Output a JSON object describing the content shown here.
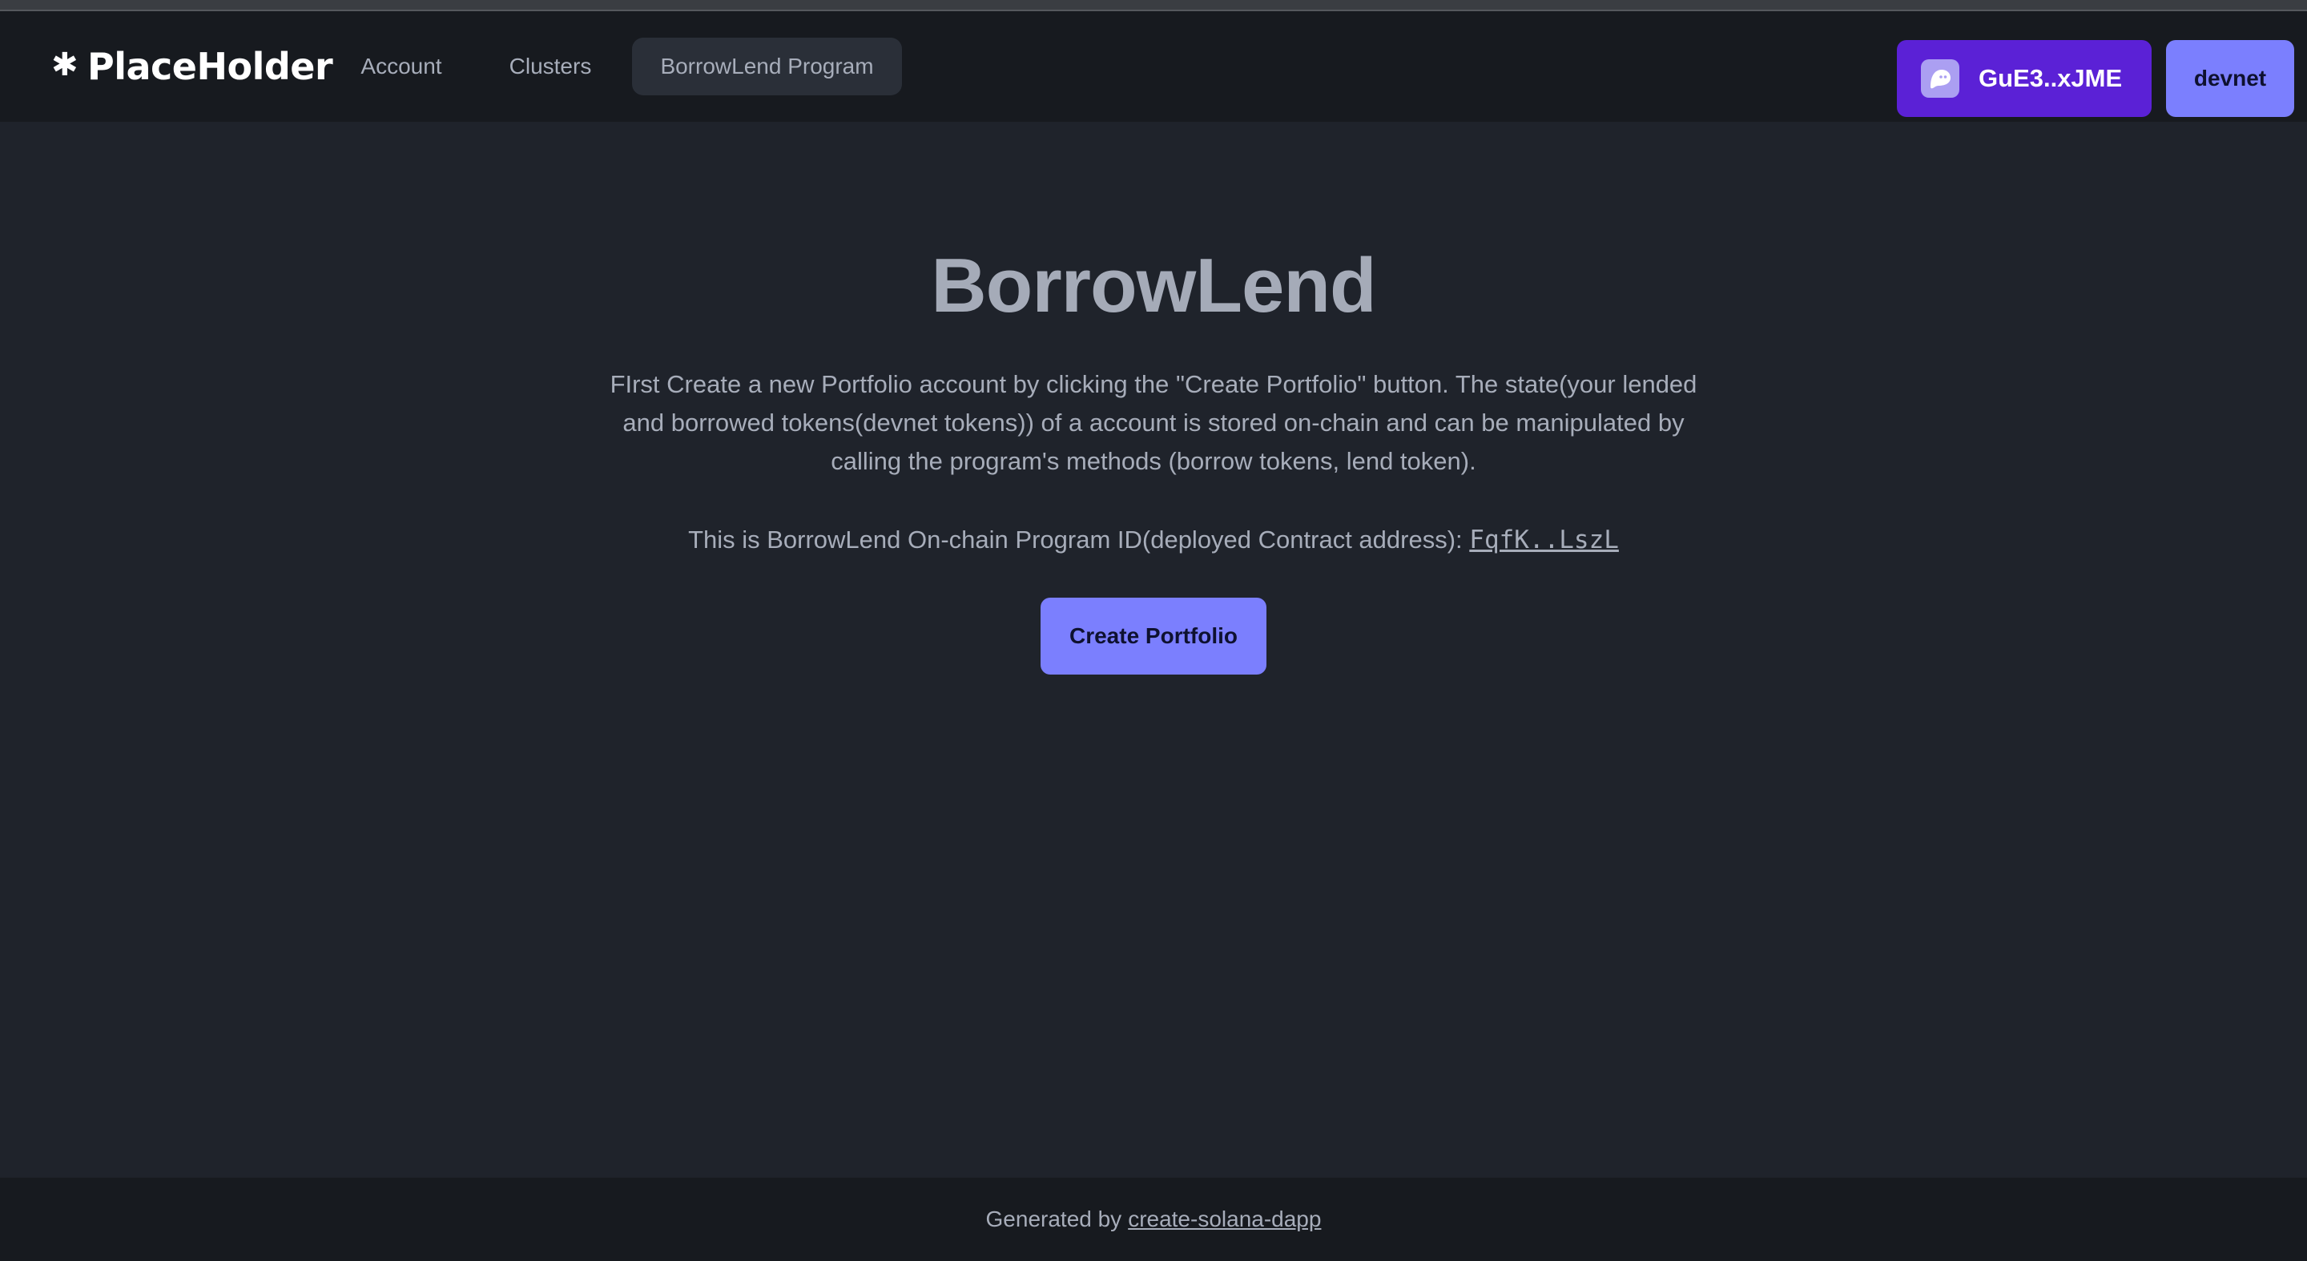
{
  "navbar": {
    "brand": "PlaceHolder",
    "brand_icon": "asterisk-icon",
    "links": [
      {
        "label": "Account",
        "active": false
      },
      {
        "label": "Clusters",
        "active": false
      },
      {
        "label": "BorrowLend Program",
        "active": true
      }
    ],
    "wallet": {
      "label": "GuE3..xJME",
      "icon": "phantom-ghost-icon"
    },
    "cluster": {
      "label": "devnet"
    }
  },
  "main": {
    "title": "BorrowLend",
    "description": "FIrst Create a new Portfolio account by clicking the \"Create Portfolio\" button. The state(your lended and borrowed tokens(devnet tokens)) of a account is stored on-chain and can be manipulated by calling the program's methods (borrow tokens, lend token).",
    "program_prefix": "This is BorrowLend On-chain Program ID(deployed Contract address):",
    "program_id": "FqfK..LszL",
    "create_button": "Create Portfolio"
  },
  "footer": {
    "prefix": "Generated by",
    "link": "create-solana-dapp"
  },
  "colors": {
    "background": "#1f232b",
    "navbar": "#171a1f",
    "wallet_button": "#5b21d6",
    "accent_button": "#7b7ffe",
    "text_muted": "#a7adba"
  }
}
